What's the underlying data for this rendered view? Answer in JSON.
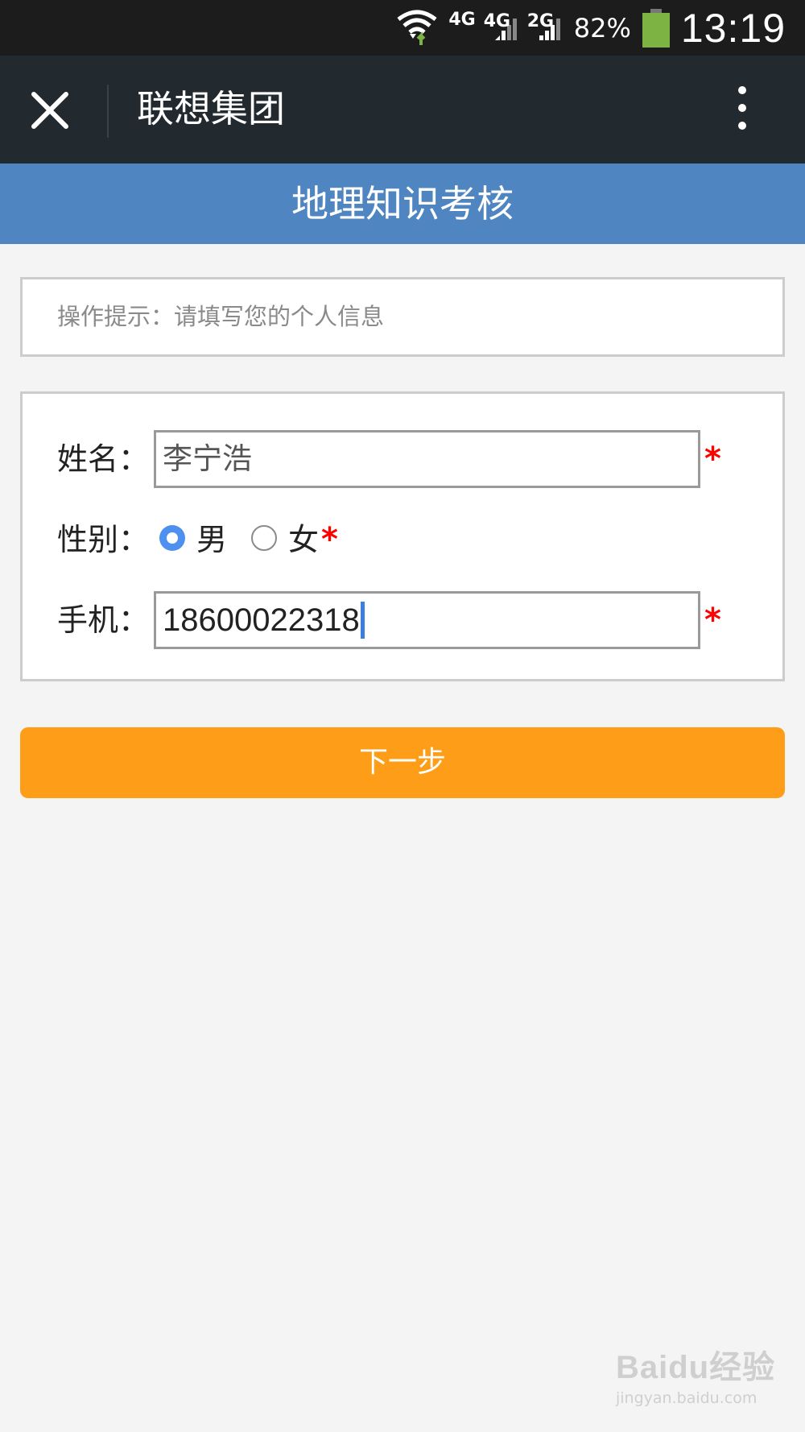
{
  "status_bar": {
    "wifi_icon": "wifi-icon",
    "net1": "4G",
    "net2": "4G",
    "net3": "2G",
    "battery_percent": "82%",
    "battery_color": "#7cb342",
    "time": "13:19"
  },
  "nav": {
    "close_icon": "close-icon",
    "title": "联想集团",
    "more_icon": "more-vertical-icon"
  },
  "header": {
    "title": "地理知识考核",
    "color": "#4f86c2"
  },
  "tip": {
    "text": "操作提示：请填写您的个人信息"
  },
  "form": {
    "name_label": "姓名：",
    "name_value": "李宁浩",
    "gender_label": "性别：",
    "gender_male": "男",
    "gender_female": "女",
    "gender_selected": "男",
    "phone_label": "手机：",
    "phone_value": "18600022318",
    "required_mark": "*"
  },
  "actions": {
    "next_label": "下一步",
    "next_color": "#fe9d17"
  },
  "watermark": {
    "main": "Baidu经验",
    "sub": "jingyan.baidu.com"
  }
}
